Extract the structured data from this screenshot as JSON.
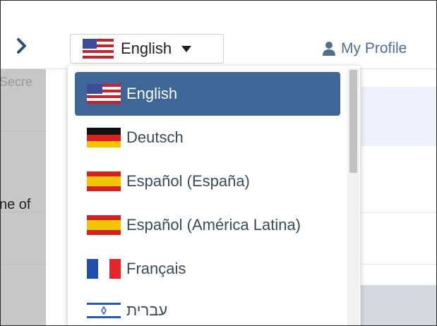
{
  "header": {
    "nav_arrow_icon": "chevron-right-icon",
    "language_selector": {
      "selected_label": "English",
      "flag_icon": "us-flag-icon",
      "caret_icon": "caret-down-icon"
    },
    "profile": {
      "label": "My Profile",
      "icon": "user-icon"
    }
  },
  "background": {
    "partial_texts": [
      "Secre",
      "ne of"
    ]
  },
  "language_menu": {
    "items": [
      {
        "label": "English",
        "flag": "us-flag-icon",
        "selected": true
      },
      {
        "label": "Deutsch",
        "flag": "germany-flag-icon",
        "selected": false
      },
      {
        "label": "Español (España)",
        "flag": "spain-flag-icon",
        "selected": false
      },
      {
        "label": "Español (América Latina)",
        "flag": "spain-flag-icon",
        "selected": false
      },
      {
        "label": "Français",
        "flag": "france-flag-icon",
        "selected": false
      },
      {
        "label": "עברית",
        "flag": "israel-flag-icon",
        "selected": false
      }
    ]
  },
  "colors": {
    "selected_bg": "#3e6696",
    "profile_text": "#4f6f8c",
    "menu_text": "#3b4a5a"
  }
}
